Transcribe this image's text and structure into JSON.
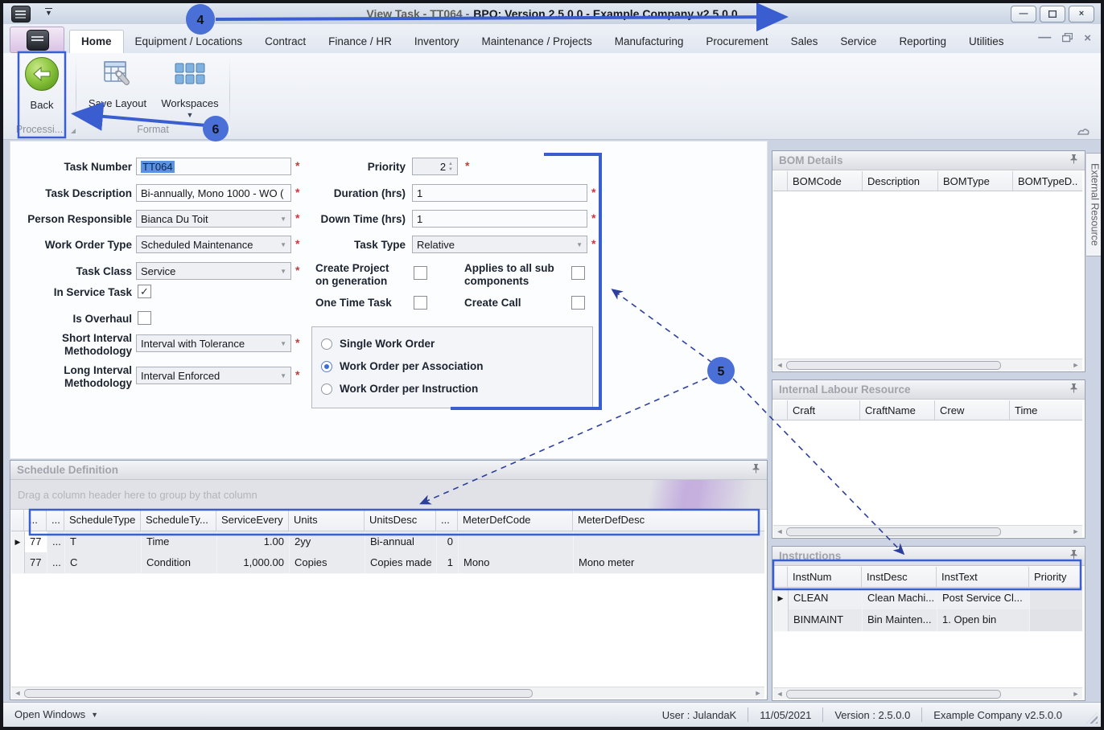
{
  "window": {
    "title_secondary": "View Task - TT064 -",
    "title_primary": "BPO: Version 2.5.0.0 - Example Company v2.5.0.0"
  },
  "tabs": {
    "items": [
      "Home",
      "Equipment / Locations",
      "Contract",
      "Finance / HR",
      "Inventory",
      "Maintenance / Projects",
      "Manufacturing",
      "Procurement",
      "Sales",
      "Service",
      "Reporting",
      "Utilities"
    ],
    "active": "Home"
  },
  "ribbon": {
    "back": "Back",
    "save_layout": "Save Layout",
    "workspaces": "Workspaces",
    "group_processing": "Processi...",
    "group_format": "Format"
  },
  "form": {
    "task_number": {
      "label": "Task Number",
      "value": "TT064"
    },
    "task_description": {
      "label": "Task Description",
      "value": "Bi-annually, Mono 1000 - WO ("
    },
    "person_responsible": {
      "label": "Person Responsible",
      "value": "Bianca Du Toit"
    },
    "work_order_type": {
      "label": "Work Order Type",
      "value": "Scheduled Maintenance"
    },
    "task_class": {
      "label": "Task Class",
      "value": "Service"
    },
    "in_service_task": {
      "label": "In Service Task",
      "checked": true,
      "glyph": "✓"
    },
    "is_overhaul": {
      "label": "Is Overhaul",
      "checked": false,
      "glyph": ""
    },
    "short_interval": {
      "label": "Short Interval Methodology",
      "value": "Interval with Tolerance"
    },
    "long_interval": {
      "label": "Long Interval Methodology",
      "value": "Interval Enforced"
    },
    "priority": {
      "label": "Priority",
      "value": "2"
    },
    "duration": {
      "label": "Duration (hrs)",
      "value": "1"
    },
    "down_time": {
      "label": "Down Time (hrs)",
      "value": "1"
    },
    "task_type": {
      "label": "Task Type",
      "value": "Relative"
    },
    "create_project": {
      "label": "Create Project on generation",
      "checked": false,
      "glyph": ""
    },
    "applies_sub": {
      "label": "Applies to all sub components",
      "checked": false,
      "glyph": ""
    },
    "one_time_task": {
      "label": "One Time Task",
      "checked": false,
      "glyph": ""
    },
    "create_call": {
      "label": "Create Call",
      "checked": false,
      "glyph": ""
    },
    "work_order_mode": {
      "options": [
        "Single Work Order",
        "Work Order per Association",
        "Work Order per Instruction"
      ],
      "selected": "Work Order per Association"
    }
  },
  "schedule": {
    "title": "Schedule Definition",
    "group_hint": "Drag a column header here to group by that column",
    "columns": [
      "...",
      "...",
      "ScheduleType",
      "ScheduleTy...",
      "ServiceEvery",
      "Units",
      "UnitsDesc",
      "...",
      "MeterDefCode",
      "MeterDefDesc"
    ],
    "rows": [
      [
        "77",
        "...",
        "T",
        "Time",
        "1.00",
        "2yy",
        "Bi-annual",
        "0",
        "",
        ""
      ],
      [
        "77",
        "...",
        "C",
        "Condition",
        "1,000.00",
        "Copies",
        "Copies made",
        "1",
        "Mono",
        "Mono meter"
      ]
    ]
  },
  "bom": {
    "title": "BOM Details",
    "columns": [
      "BOMCode",
      "Description",
      "BOMType",
      "BOMTypeD.."
    ]
  },
  "labour": {
    "title": "Internal Labour Resource",
    "columns": [
      "Craft",
      "CraftName",
      "Crew",
      "Time"
    ]
  },
  "instructions": {
    "title": "Instructions",
    "columns": [
      "InstNum",
      "InstDesc",
      "InstText",
      "Priority"
    ],
    "rows": [
      [
        "CLEAN",
        "Clean Machi...",
        "Post Service Cl...",
        ""
      ],
      [
        "BINMAINT",
        "Bin Mainten...",
        "1. Open bin",
        ""
      ]
    ]
  },
  "external_tab": "External Resource",
  "status": {
    "open_windows": "Open Windows",
    "user": "User : JulandaK",
    "date": "11/05/2021",
    "version": "Version : 2.5.0.0",
    "company": "Example Company v2.5.0.0"
  },
  "annotations": {
    "n4": "4",
    "n5": "5",
    "n6": "6",
    "accent": "#3a5ecf"
  }
}
